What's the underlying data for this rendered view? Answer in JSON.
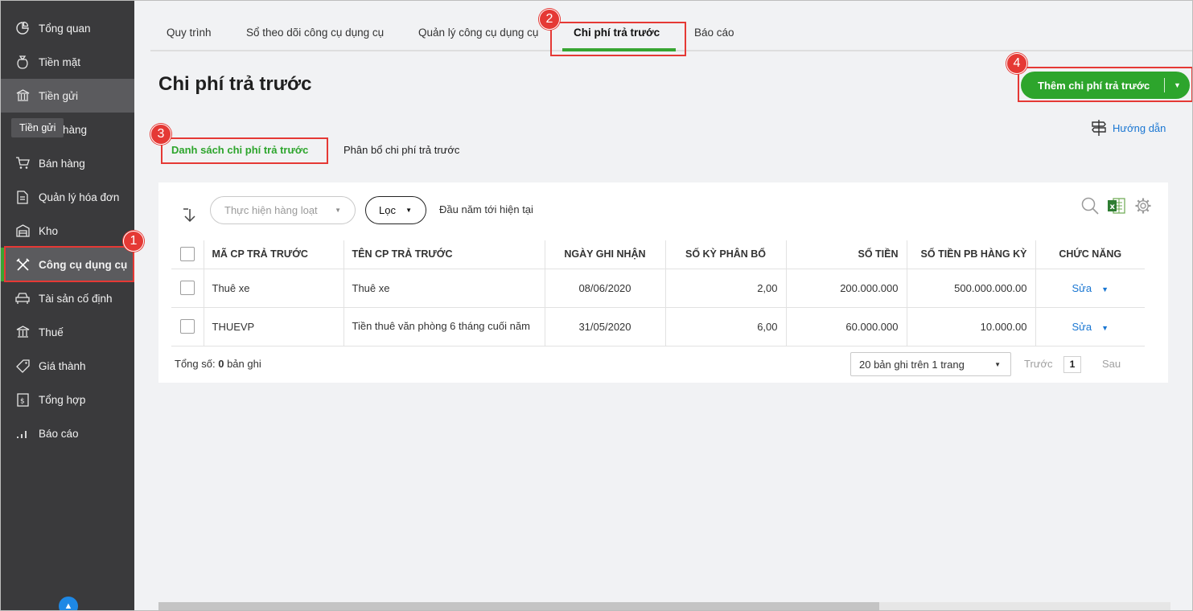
{
  "sidebar": {
    "items": [
      {
        "label": "Tổng quan",
        "icon": "dashboard-icon"
      },
      {
        "label": "Tiền mặt",
        "icon": "money-bag-icon"
      },
      {
        "label": "Tiền gửi",
        "icon": "bank-icon"
      },
      {
        "label": "Mua hàng",
        "icon": "truck-icon"
      },
      {
        "label": "Bán hàng",
        "icon": "cart-icon"
      },
      {
        "label": "Quản lý hóa đơn",
        "icon": "invoice-icon"
      },
      {
        "label": "Kho",
        "icon": "warehouse-icon"
      },
      {
        "label": "Công cụ dụng cụ",
        "icon": "tools-icon"
      },
      {
        "label": "Tài sản cố định",
        "icon": "car-icon"
      },
      {
        "label": "Thuế",
        "icon": "tax-icon"
      },
      {
        "label": "Giá thành",
        "icon": "price-tag-icon"
      },
      {
        "label": "Tổng hợp",
        "icon": "ledger-icon"
      },
      {
        "label": "Báo cáo",
        "icon": "bar-chart-icon"
      }
    ],
    "tooltip": "Tiền gửi"
  },
  "tabs": [
    "Quy trình",
    "Sổ theo dõi công cụ dụng cụ",
    "Quản lý công cụ dụng cụ",
    "Chi phí trả trước",
    "Báo cáo"
  ],
  "page_title": "Chi phí trả trước",
  "add_button": "Thêm chi phí trả trước",
  "guide": "Hướng dẫn",
  "subtabs": [
    "Danh sách chi phí trả trước",
    "Phân bổ chi phí trả trước"
  ],
  "toolbar": {
    "bulk_action": "Thực hiện hàng loạt",
    "filter": "Lọc",
    "period": "Đầu năm tới hiện tại"
  },
  "table": {
    "headers": [
      "MÃ CP TRẢ TRƯỚC",
      "TÊN CP TRẢ TRƯỚC",
      "NGÀY GHI NHẬN",
      "SỐ KỲ PHÂN BỔ",
      "SỐ TIỀN",
      "SỐ TIỀN PB HÀNG KỲ",
      "CHỨC NĂNG"
    ],
    "rows": [
      {
        "code": "Thuê xe",
        "name": "Thuê xe",
        "date": "08/06/2020",
        "periods": "2,00",
        "amount": "200.000.000",
        "per_period": "500.000.000.00",
        "action": "Sửa"
      },
      {
        "code": "THUEVP",
        "name": "Tiền thuê văn phòng 6 tháng cuối năm",
        "date": "31/05/2020",
        "periods": "6,00",
        "amount": "60.000.000",
        "per_period": "10.000.00",
        "action": "Sửa"
      }
    ]
  },
  "footer": {
    "total_label": "Tổng số:",
    "total_count": "0",
    "total_suffix": "bản ghi",
    "page_size": "20 bản ghi trên 1 trang",
    "prev": "Trước",
    "page": "1",
    "next": "Sau"
  },
  "annotations": [
    "1",
    "2",
    "3",
    "4"
  ],
  "colors": {
    "accent": "#2da52c",
    "sidebar": "#3a3a3c",
    "highlight": "#e53935",
    "link": "#1976d2"
  }
}
